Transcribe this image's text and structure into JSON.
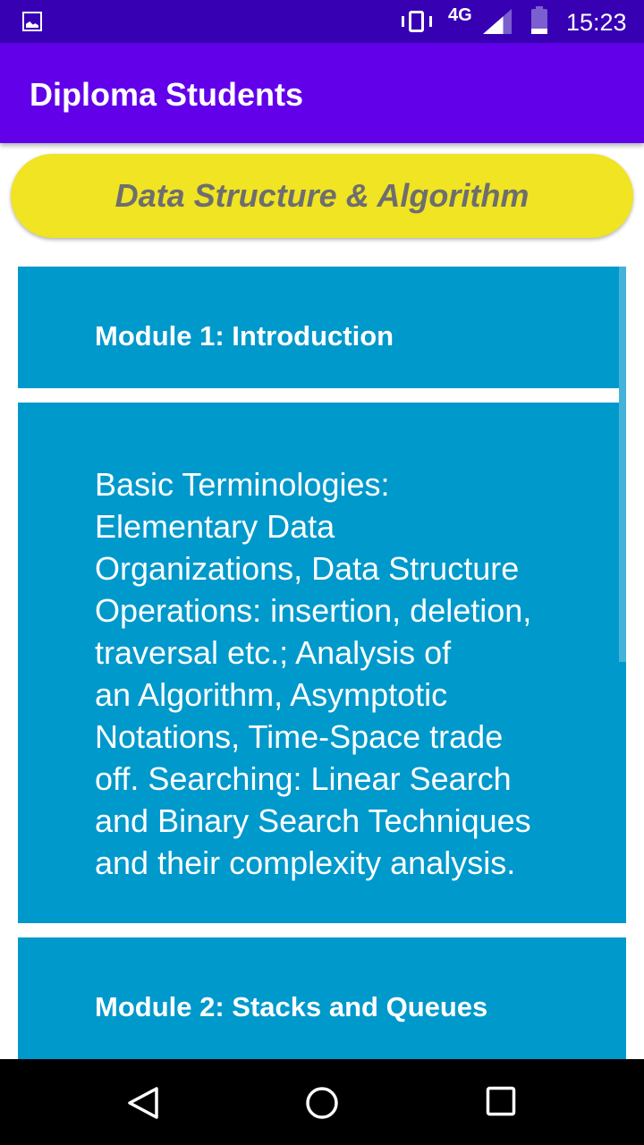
{
  "status_bar": {
    "network": "4G",
    "time": "15:23",
    "icons": [
      "image-icon",
      "vibrate-icon",
      "signal-icon",
      "battery-icon"
    ]
  },
  "app_bar": {
    "title": "Diploma Students"
  },
  "subject": {
    "title": "Data Structure & Algorithm"
  },
  "modules": [
    {
      "title": "Module 1: Introduction",
      "description": "Basic Terminologies:\nElementary Data\nOrganizations, Data Structure\nOperations: insertion, deletion,\ntraversal etc.; Analysis of\nan Algorithm, Asymptotic\nNotations, Time-Space trade\noff. Searching: Linear Search\nand Binary Search Techniques\nand their complexity analysis."
    },
    {
      "title": "Module 2: Stacks and Queues"
    }
  ],
  "nav_bar": {
    "icons": [
      "back-icon",
      "home-icon",
      "recents-icon"
    ]
  },
  "colors": {
    "status": "#3700b3",
    "app_bar": "#6200ea",
    "pill": "#f0e423",
    "card": "#0099cc"
  }
}
